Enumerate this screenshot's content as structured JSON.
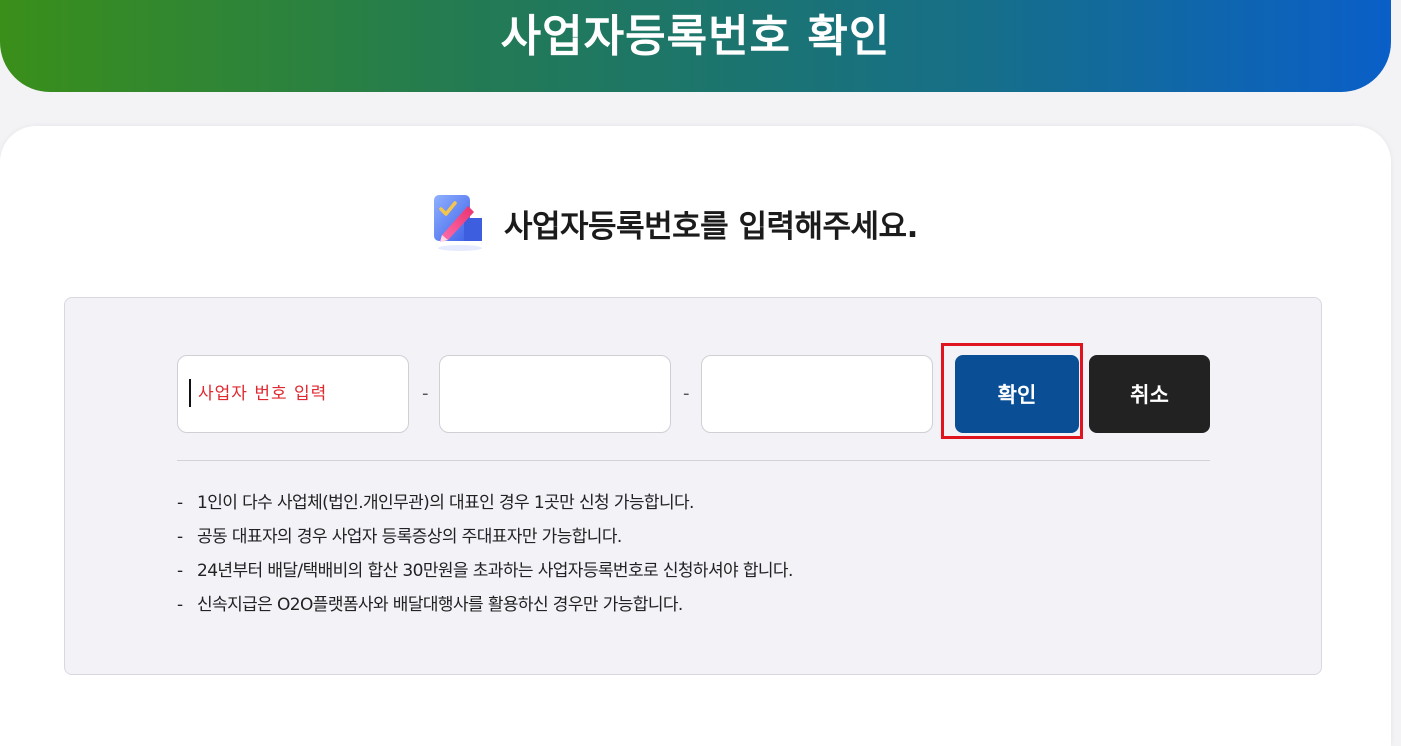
{
  "header": {
    "title": "사업자등록번호 확인"
  },
  "prompt": {
    "icon": "checklist-pencil-icon",
    "text": "사업자등록번호를 입력해주세요."
  },
  "form": {
    "fields": [
      {
        "placeholder": "사업자 번호 입력",
        "value": ""
      },
      {
        "placeholder": "",
        "value": ""
      },
      {
        "placeholder": "",
        "value": ""
      }
    ],
    "separator": "-",
    "confirm_label": "확인",
    "cancel_label": "취소"
  },
  "notes": [
    "1인이 다수 사업체(법인.개인무관)의 대표인 경우 1곳만 신청 가능합니다.",
    "공동 대표자의 경우 사업자 등록증상의 주대표자만 가능합니다.",
    "24년부터 배달/택배비의 합산 30만원을 초과하는 사업자등록번호로 신청하셔야 합니다.",
    "신속지급은 O2O플랫폼사와 배달대행사를 활용하신 경우만 가능합니다."
  ],
  "note_bullet": "-",
  "colors": {
    "header_gradient_start": "#3a8f1a",
    "header_gradient_end": "#0a5fc8",
    "confirm_button": "#0a4f96",
    "cancel_button": "#222222",
    "placeholder": "#e0282f",
    "highlight": "#e0141e"
  }
}
